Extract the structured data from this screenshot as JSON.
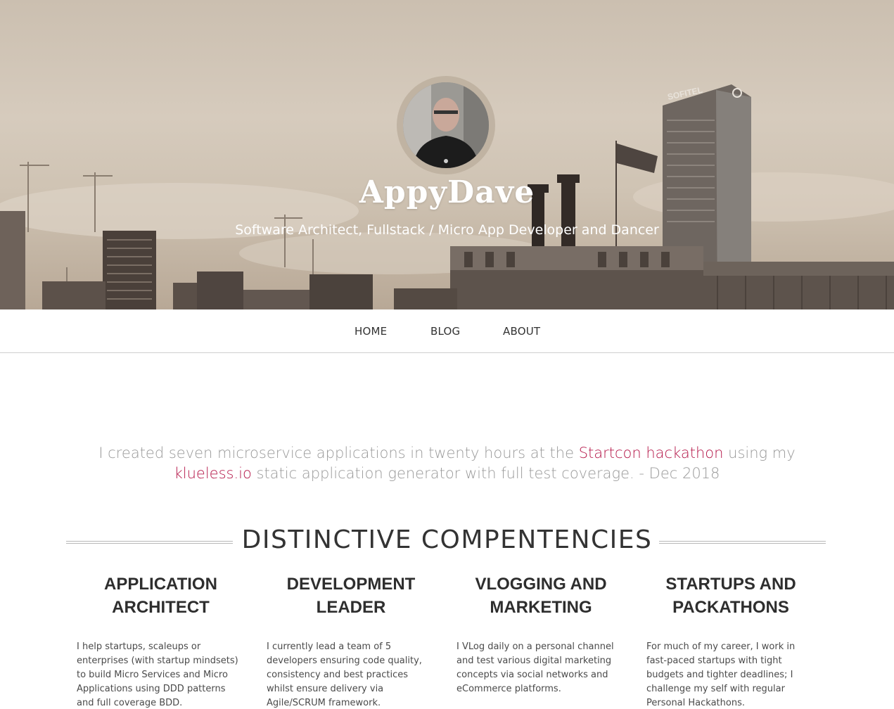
{
  "site": {
    "title": "AppyDave",
    "tagline": "Software Architect, Fullstack / Micro App Developer and Dancer"
  },
  "hero": {
    "building_sign": "SOFITEL"
  },
  "nav": {
    "items": [
      {
        "label": "HOME"
      },
      {
        "label": "BLOG"
      },
      {
        "label": "ABOUT"
      }
    ]
  },
  "quote": {
    "part1": "I created seven microservice applications in twenty hours at the ",
    "link1": "Startcon hackathon",
    "part2": " using my ",
    "link2": "klueless.io",
    "part3": " static application generator with full test coverage. - Dec 2018"
  },
  "competencies": {
    "heading": "DISTINCTIVE COMPENTENCIES",
    "items": [
      {
        "title": "APPLICATION ARCHITECT",
        "body": "I help startups, scaleups or enterprises (with startup mindsets) to build Micro Services and Micro Applications using DDD patterns and full coverage BDD."
      },
      {
        "title": "DEVELOPMENT LEADER",
        "body": "I currently lead a team of 5 developers ensuring code quality, consistency and best practices whilst ensure delivery via Agile/SCRUM framework."
      },
      {
        "title": "VLOGGING AND MARKETING",
        "body": "I VLog daily on a personal channel and test various digital marketing concepts via social networks and eCommerce platforms."
      },
      {
        "title": "STARTUPS AND PACKATHONS",
        "body": "For much of my career, I work in fast-paced startups with tight budgets and tighter deadlines; I challenge my self with regular Personal Hackathons."
      }
    ]
  },
  "colors": {
    "accent_link": "#b5184a",
    "hero_tint": "#cbbfb0"
  }
}
